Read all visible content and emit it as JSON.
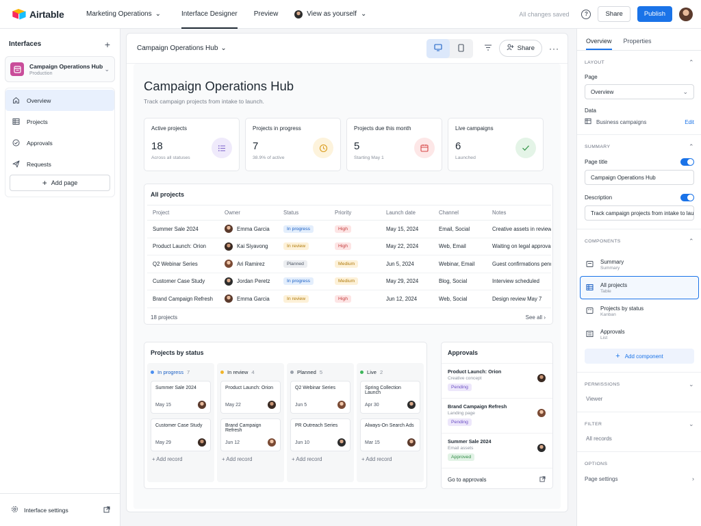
{
  "topbar": {
    "logo": "Airtable",
    "base": "Marketing Operations",
    "tabs": [
      "Interface Designer",
      "Preview"
    ],
    "view_as": "View as yourself",
    "saved": "All changes saved",
    "share": "Share",
    "publish": "Publish"
  },
  "left": {
    "title": "Interfaces",
    "interface_name": "Campaign Operations Hub",
    "interface_sub": "Production",
    "nav": [
      {
        "label": "Overview",
        "icon": "home-icon"
      },
      {
        "label": "Projects",
        "icon": "table-icon"
      },
      {
        "label": "Approvals",
        "icon": "check-circle-icon"
      },
      {
        "label": "Requests",
        "icon": "send-icon"
      }
    ],
    "add_page": "Add page",
    "settings": "Interface settings"
  },
  "canvas": {
    "title": "Campaign Operations Hub",
    "share": "Share"
  },
  "page": {
    "title": "Campaign Operations Hub",
    "description": "Track campaign projects from intake to launch."
  },
  "stats": [
    {
      "label": "Active projects",
      "value": "18",
      "sub": "Across all statuses",
      "icon": "list-icon",
      "color": "#7b61c9",
      "bg": "#efeafb"
    },
    {
      "label": "Projects in progress",
      "value": "7",
      "sub": "38.9% of active",
      "icon": "clock-icon",
      "color": "#d99a18",
      "bg": "#fdf3dc"
    },
    {
      "label": "Projects due this month",
      "value": "5",
      "sub": "Starting May 1",
      "icon": "calendar-icon",
      "color": "#d64545",
      "bg": "#fde7e7"
    },
    {
      "label": "Live campaigns",
      "value": "6",
      "sub": "Launched",
      "icon": "check-icon",
      "color": "#3c9a4f",
      "bg": "#e4f4e7"
    }
  ],
  "projects_table": {
    "title": "All projects",
    "columns": [
      "Project",
      "Owner",
      "Status",
      "Priority",
      "Launch date",
      "Channel",
      "Notes"
    ],
    "rows": [
      {
        "project": "Summer Sale 2024",
        "owner": "Emma Garcia",
        "status": "In progress",
        "priority": "High",
        "date": "May 15, 2024",
        "channel": "Email, Social",
        "notes": "Creative assets in review"
      },
      {
        "project": "Product Launch: Orion",
        "owner": "Kai Siyavong",
        "status": "In review",
        "priority": "High",
        "date": "May 22, 2024",
        "channel": "Web, Email",
        "notes": "Waiting on legal approval"
      },
      {
        "project": "Q2 Webinar Series",
        "owner": "Ari Ramirez",
        "status": "Planned",
        "priority": "Medium",
        "date": "Jun 5, 2024",
        "channel": "Webinar, Email",
        "notes": "Guest confirmations pending"
      },
      {
        "project": "Customer Case Study",
        "owner": "Jordan Peretz",
        "status": "In progress",
        "priority": "Medium",
        "date": "May 29, 2024",
        "channel": "Blog, Social",
        "notes": "Interview scheduled"
      },
      {
        "project": "Brand Campaign Refresh",
        "owner": "Emma Garcia",
        "status": "In review",
        "priority": "High",
        "date": "Jun 12, 2024",
        "channel": "Web, Social",
        "notes": "Design review May 7"
      }
    ],
    "count": "18 projects",
    "see_all": "See all"
  },
  "status_colors": {
    "In progress": {
      "bg": "#e3eefc",
      "fg": "#1a5fc4"
    },
    "In review": {
      "bg": "#fdf1d8",
      "fg": "#b07a0a"
    },
    "Planned": {
      "bg": "#eceef1",
      "fg": "#4a5361"
    },
    "High": {
      "bg": "#fde5e5",
      "fg": "#c43b3b"
    },
    "Medium": {
      "bg": "#fdf1d8",
      "fg": "#b07a0a"
    },
    "Pending": {
      "bg": "#ede7fb",
      "fg": "#6b4fc4"
    },
    "Approved": {
      "bg": "#e2f3e6",
      "fg": "#2f8a44"
    }
  },
  "kanban": {
    "title": "Projects by status",
    "columns": [
      {
        "name": "In progress",
        "count": "7",
        "dot": "#4a8ef0",
        "cards": [
          {
            "title": "Summer Sale 2024",
            "date": "May 15"
          },
          {
            "title": "Customer Case Study",
            "date": "May 29"
          }
        ]
      },
      {
        "name": "In review",
        "count": "4",
        "dot": "#f0b429",
        "cards": [
          {
            "title": "Product Launch: Orion",
            "date": "May 22"
          },
          {
            "title": "Brand Campaign Refresh",
            "date": "Jun 12"
          }
        ]
      },
      {
        "name": "Planned",
        "count": "5",
        "dot": "#9aa1ab",
        "cards": [
          {
            "title": "Q2 Webinar Series",
            "date": "Jun 5"
          },
          {
            "title": "PR Outreach Series",
            "date": "Jun 10"
          }
        ]
      },
      {
        "name": "Live",
        "count": "2",
        "dot": "#3cb55a",
        "cards": [
          {
            "title": "Spring Collection Launch",
            "date": "Apr 30"
          },
          {
            "title": "Always-On Search Ads",
            "date": "Mar 15"
          }
        ]
      }
    ],
    "add_record": "Add record"
  },
  "approvals": {
    "title": "Approvals",
    "items": [
      {
        "title": "Product Launch: Orion",
        "sub": "Creative concept",
        "status": "Pending"
      },
      {
        "title": "Brand Campaign Refresh",
        "sub": "Landing page",
        "status": "Pending"
      },
      {
        "title": "Summer Sale 2024",
        "sub": "Email assets",
        "status": "Approved"
      }
    ],
    "go_to": "Go to approvals"
  },
  "right": {
    "tabs": [
      "Overview",
      "Properties"
    ],
    "layout": {
      "head": "LAYOUT",
      "page_label": "Page",
      "page_value": "Overview",
      "data_label": "Data",
      "data_value": "Business campaigns",
      "edit": "Edit"
    },
    "summary": {
      "head": "SUMMARY",
      "page_title_label": "Page title",
      "page_title_value": "Campaign Operations Hub",
      "desc_label": "Description",
      "desc_value": "Track campaign projects from intake to launch."
    },
    "components": {
      "head": "COMPONENTS",
      "items": [
        {
          "name": "Summary",
          "sub": "Summary",
          "icon": "summary-icon"
        },
        {
          "name": "All projects",
          "sub": "Table",
          "icon": "table-icon"
        },
        {
          "name": "Projects by status",
          "sub": "Kanban",
          "icon": "kanban-icon"
        },
        {
          "name": "Approvals",
          "sub": "List",
          "icon": "list-icon"
        }
      ],
      "add": "Add component"
    },
    "permissions": {
      "head": "PERMISSIONS",
      "value": "Viewer"
    },
    "filter": {
      "head": "FILTER",
      "value": "All records"
    },
    "options": {
      "head": "OPTIONS",
      "value": "Page settings"
    }
  }
}
